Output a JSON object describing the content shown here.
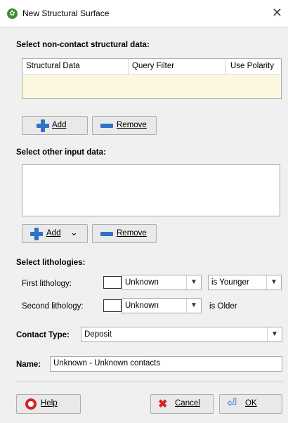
{
  "window": {
    "title": "New Structural Surface",
    "close_glyph": "✕",
    "app_icon_glyph": "✿"
  },
  "structural_section": {
    "label": "Select non-contact structural data:",
    "columns": [
      "Structural Data",
      "Query Filter",
      "Use Polarity"
    ],
    "rows": [],
    "add_label": "Add",
    "remove_label": "Remove"
  },
  "other_input_section": {
    "label": "Select other input data:",
    "items": [],
    "add_label": "Add",
    "remove_label": "Remove"
  },
  "lithologies_section": {
    "label": "Select lithologies:",
    "first": {
      "label": "First lithology:",
      "value": "Unknown",
      "relation": "is Younger"
    },
    "second": {
      "label": "Second lithology:",
      "value": "Unknown",
      "relation": "is Older"
    }
  },
  "contact_type": {
    "label": "Contact Type:",
    "value": "Deposit"
  },
  "name_field": {
    "label": "Name:",
    "value": "Unknown - Unknown contacts"
  },
  "footer": {
    "help_label": "Help",
    "cancel_label": "Cancel",
    "ok_label": "OK"
  },
  "colors": {
    "grid_body": "#fef7e0",
    "accent_blue": "#2f73c7",
    "icon_red": "#d42222"
  }
}
